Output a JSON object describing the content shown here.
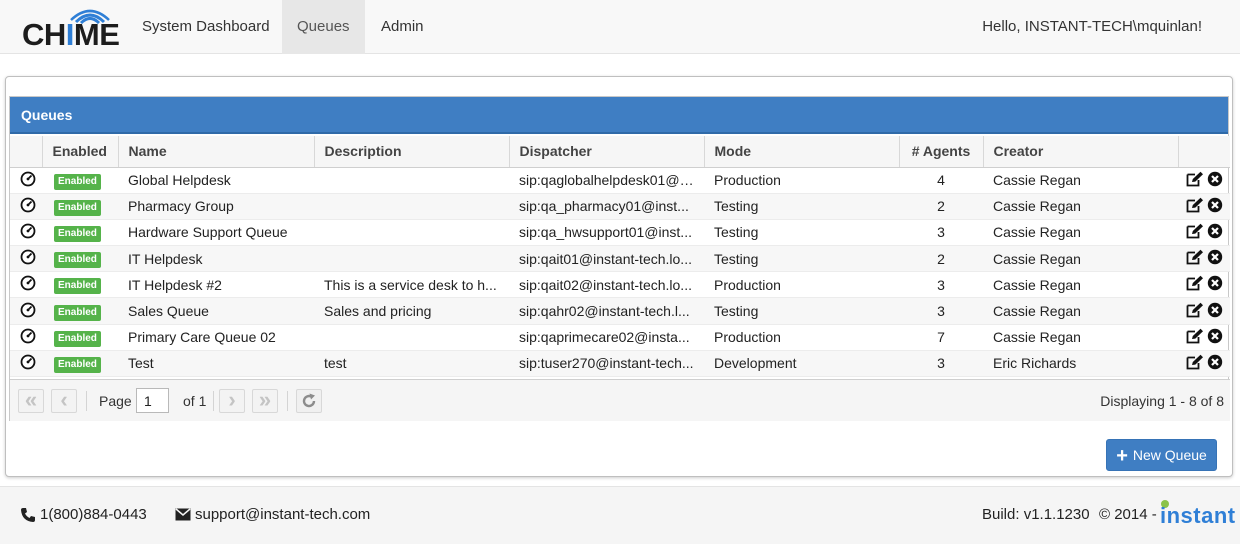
{
  "nav": {
    "logo_part1": "CH",
    "logo_part2": "I",
    "logo_part3": "ME",
    "items": [
      "System Dashboard",
      "Queues",
      "Admin"
    ],
    "active": "Queues",
    "greeting": "Hello, INSTANT-TECH\\mquinlan!"
  },
  "grid": {
    "title": "Queues",
    "columns": [
      "Enabled",
      "Name",
      "Description",
      "Dispatcher",
      "Mode",
      "# Agents",
      "Creator"
    ],
    "rows": [
      {
        "enabled": "Enabled",
        "name": "Global Helpdesk",
        "description": "",
        "dispatcher": "sip:qaglobalhelpdesk01@i...",
        "mode": "Production",
        "agents": "4",
        "creator": "Cassie Regan"
      },
      {
        "enabled": "Enabled",
        "name": "Pharmacy Group",
        "description": "",
        "dispatcher": "sip:qa_pharmacy01@inst...",
        "mode": "Testing",
        "agents": "2",
        "creator": "Cassie Regan"
      },
      {
        "enabled": "Enabled",
        "name": "Hardware Support Queue",
        "description": "",
        "dispatcher": "sip:qa_hwsupport01@inst...",
        "mode": "Testing",
        "agents": "3",
        "creator": "Cassie Regan"
      },
      {
        "enabled": "Enabled",
        "name": "IT Helpdesk",
        "description": "",
        "dispatcher": "sip:qait01@instant-tech.lo...",
        "mode": "Testing",
        "agents": "2",
        "creator": "Cassie Regan"
      },
      {
        "enabled": "Enabled",
        "name": "IT Helpdesk #2",
        "description": "This is a service desk to h...",
        "dispatcher": "sip:qait02@instant-tech.lo...",
        "mode": "Production",
        "agents": "3",
        "creator": "Cassie Regan"
      },
      {
        "enabled": "Enabled",
        "name": "Sales Queue",
        "description": "Sales and pricing",
        "dispatcher": "sip:qahr02@instant-tech.l...",
        "mode": "Testing",
        "agents": "3",
        "creator": "Cassie Regan"
      },
      {
        "enabled": "Enabled",
        "name": "Primary Care Queue 02",
        "description": "",
        "dispatcher": "sip:qaprimecare02@insta...",
        "mode": "Production",
        "agents": "7",
        "creator": "Cassie Regan"
      },
      {
        "enabled": "Enabled",
        "name": "Test",
        "description": "test",
        "dispatcher": "sip:tuser270@instant-tech...",
        "mode": "Development",
        "agents": "3",
        "creator": "Eric Richards"
      }
    ]
  },
  "pager": {
    "page_label": "Page",
    "page_value": "1",
    "of_label": "of 1",
    "display": "Displaying 1 - 8 of 8"
  },
  "new_queue_label": "New Queue",
  "footer": {
    "phone": "1(800)884-0443",
    "email": "support@instant-tech.com",
    "build": "Build: v1.1.1230",
    "copyright": "© 2014 -",
    "brand": "instant"
  },
  "colors": {
    "primary": "#3f7ec3",
    "badge": "#55b34a",
    "logo_blue": "#2f7fd6"
  },
  "icons": [
    "gauge-icon",
    "edit-icon",
    "delete-icon",
    "first-page-icon",
    "prev-page-icon",
    "next-page-icon",
    "last-page-icon",
    "refresh-icon",
    "phone-icon",
    "envelope-icon",
    "plus-icon"
  ]
}
